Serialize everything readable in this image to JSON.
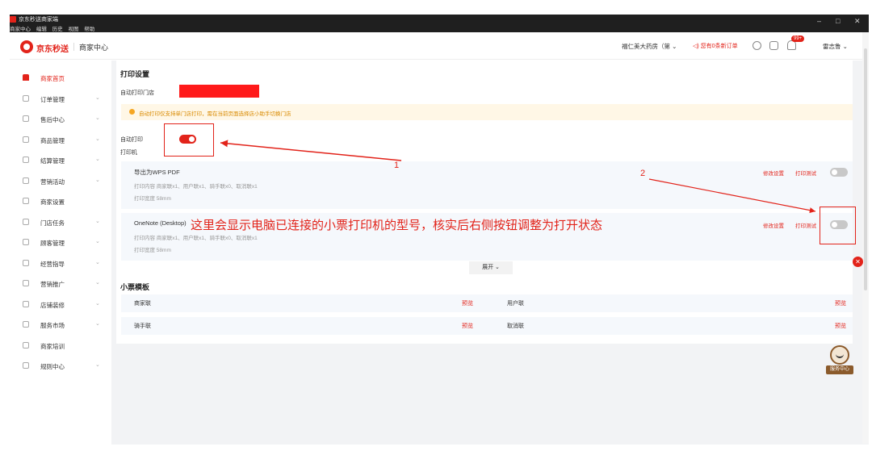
{
  "window": {
    "title": "京东秒送商家端",
    "menu": [
      "商家中心",
      "编辑",
      "历史",
      "视图",
      "帮助"
    ],
    "controls": {
      "minimize": "–",
      "restore": "□",
      "close": "✕"
    }
  },
  "header": {
    "brand": "京东秒送",
    "sub": "商家中心",
    "store": "福仁美大药房（第",
    "order_alert": "您有0条新订单",
    "badge": "99+",
    "user": "雷志鲁"
  },
  "sidebar": {
    "items": [
      {
        "label": "商家首页",
        "chevron": ""
      },
      {
        "label": "订单管理",
        "chevron": "⌄"
      },
      {
        "label": "售后中心",
        "chevron": "⌄"
      },
      {
        "label": "商品管理",
        "chevron": "⌄"
      },
      {
        "label": "结算管理",
        "chevron": "⌄"
      },
      {
        "label": "营销活动",
        "chevron": "⌄"
      },
      {
        "label": "商家设置",
        "chevron": ""
      },
      {
        "label": "门店任务",
        "chevron": "⌄"
      },
      {
        "label": "顾客管理",
        "chevron": "⌄"
      },
      {
        "label": "经营指导",
        "chevron": "⌄"
      },
      {
        "label": "营销推广",
        "chevron": "⌄"
      },
      {
        "label": "店铺装修",
        "chevron": "⌄"
      },
      {
        "label": "服务市场",
        "chevron": "⌄"
      },
      {
        "label": "商家培训",
        "chevron": ""
      },
      {
        "label": "规则中心",
        "chevron": "⌄"
      }
    ]
  },
  "print_settings": {
    "title": "打印设置",
    "store_label": "自动打印门店",
    "notice": "自动打印仅支持单门店打印，需在当前页面选择店小助手切换门店",
    "auto_print_label": "自动打印",
    "auto_print_on": true,
    "printer_label": "打印机",
    "printers": [
      {
        "name": "导出为WPS PDF",
        "content": "打印内容  商家联x1、用户联x1、骑手联x0、取消联x1",
        "width": "打印宽度  58mm",
        "edit": "修改设置",
        "test": "打印测试",
        "enabled": false
      },
      {
        "name": "OneNote (Desktop)",
        "content": "打印内容  商家联x1、用户联x1、骑手联x0、取消联x1",
        "width": "打印宽度  58mm",
        "edit": "修改设置",
        "test": "打印测试",
        "enabled": false
      }
    ],
    "expand": "展开 ⌄"
  },
  "templates": {
    "title": "小票模板",
    "rows": [
      {
        "left": "商家联",
        "left_preview": "预览",
        "right": "用户联",
        "right_preview": "预览"
      },
      {
        "left": "骑手联",
        "left_preview": "预览",
        "right": "取消联",
        "right_preview": "预览"
      }
    ]
  },
  "annotations": {
    "num1": "1",
    "num2": "2",
    "text": "这里会显示电脑已连接的小票打印机的型号，核实后右侧按钮调整为打开状态"
  },
  "float": {
    "close": "✕",
    "service": "服务中心"
  },
  "colors": {
    "accent": "#e2231a",
    "notice_bg": "#fff7e6",
    "row_bg": "#f5f8fc"
  }
}
